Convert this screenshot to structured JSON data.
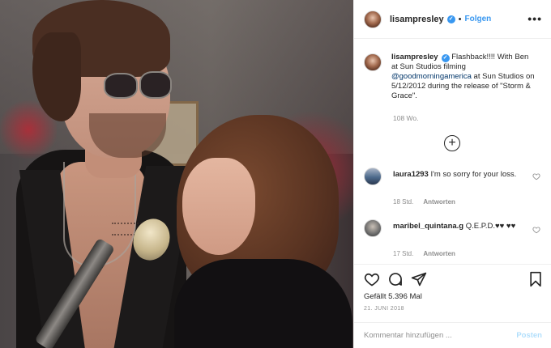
{
  "post": {
    "author": "lisampresley",
    "follow_label": "Folgen",
    "separator": "•",
    "more_label": "•••",
    "verified_mark": "✓",
    "caption_parts": {
      "before_mention": " Flashback!!!! With Ben at Sun Studios filming ",
      "mention": "@goodmorningamerica",
      "after_mention": " at Sun Studios on 5/12/2012 during the release of \"Storm & Grace\"."
    },
    "caption_time": "108 Wo.",
    "load_more_symbol": "+",
    "likes_label": "Gefällt 5.396 Mal",
    "date": "21. JUNI 2018",
    "comment_placeholder": "Kommentar hinzufügen ...",
    "post_button": "Posten"
  },
  "comments": [
    {
      "user": "laura1293",
      "text": " I'm so sorry for your loss.",
      "time": "18 Std.",
      "reply_label": "Antworten"
    },
    {
      "user": "maribel_quintana.g",
      "text": " Q.E.P.D.♥♥ ♥♥",
      "time": "17 Std.",
      "reply_label": "Antworten"
    }
  ],
  "icons": {
    "like": "heart-icon",
    "comment": "comment-bubble-icon",
    "share": "paper-plane-icon",
    "save": "bookmark-icon",
    "more": "more-options-icon",
    "load_more": "plus-circle-icon",
    "comment_like": "small-heart-icon"
  },
  "colors": {
    "accent": "#3897f0",
    "text": "#262626",
    "muted": "#8e8e8e",
    "post_disabled": "#b2dffc"
  }
}
